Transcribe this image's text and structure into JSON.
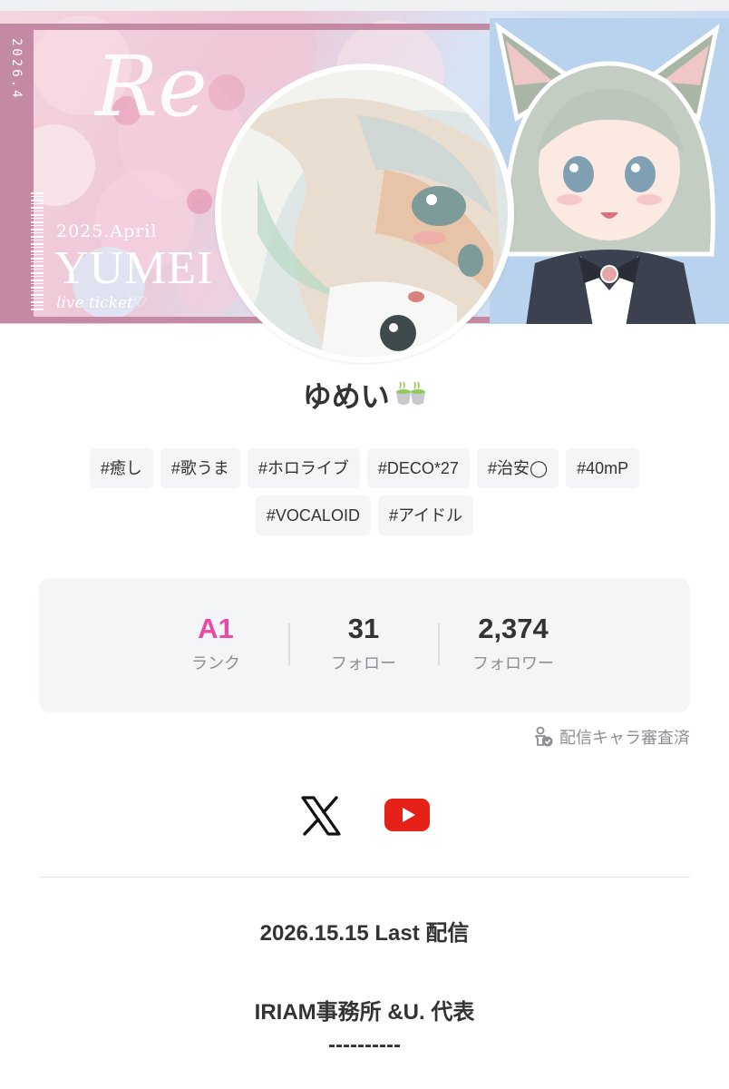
{
  "banner": {
    "stub_date": "2026.4",
    "script_text": "Re",
    "ticket_date": "2025.April",
    "ticket_title": "YUMEI",
    "ticket_sub": "live ticket♡"
  },
  "profile": {
    "name": "ゆめい",
    "name_emoji": "tea-cups"
  },
  "tags": [
    "#癒し",
    "#歌うま",
    "#ホロライブ",
    "#DECO*27",
    "#治安◯",
    "#40mP",
    "#VOCALOID",
    "#アイドル"
  ],
  "stats": {
    "rank_value": "A1",
    "rank_label": "ランク",
    "follow_value": "31",
    "follow_label": "フォロー",
    "follower_value": "2,374",
    "follower_label": "フォロワー"
  },
  "verified_text": "配信キャラ審査済",
  "social": {
    "links": [
      "x-icon",
      "youtube-icon"
    ],
    "youtube_color": "#e62117"
  },
  "bio": {
    "line1": "2026.15.15 Last 配信",
    "line2": "IRIAM事務所 &U. 代表",
    "line3": "----------"
  },
  "colors": {
    "rank_accent": "#e94aa8",
    "ticket_frame": "#c48aa3"
  }
}
